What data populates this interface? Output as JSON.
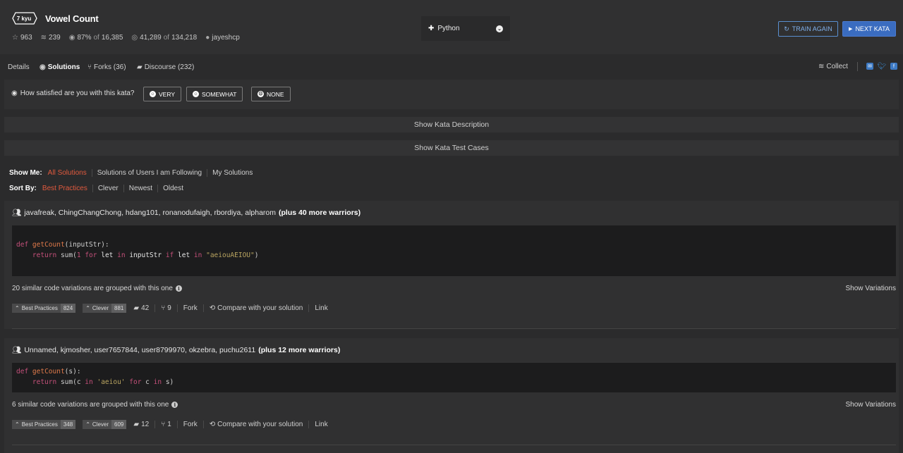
{
  "kata": {
    "rank": "7 kyu",
    "title": "Vowel Count",
    "stars": "963",
    "collections": "239",
    "satisfaction": "87%",
    "of_label": "of",
    "votes_total": "16,385",
    "completed": "41,289",
    "attempted": "134,218",
    "author": "jayeshcp"
  },
  "language": {
    "selected": "Python"
  },
  "buttons": {
    "train_again": "TRAIN AGAIN",
    "next_kata": "NEXT KATA"
  },
  "tabs": [
    {
      "label": "Details"
    },
    {
      "label": "Solutions"
    },
    {
      "label": "Forks (36)"
    },
    {
      "label": "Discourse (232)"
    }
  ],
  "collect_label": "Collect",
  "satisfaction": {
    "question": "How satisfied are you with this kata?",
    "options": [
      "VERY",
      "SOMEWHAT",
      "NONE"
    ]
  },
  "bars": {
    "description": "Show Kata Description",
    "tests": "Show Kata Test Cases"
  },
  "filters": {
    "show_label": "Show Me:",
    "show_options": [
      "All Solutions",
      "Solutions of Users I am Following",
      "My Solutions"
    ],
    "sort_label": "Sort By:",
    "sort_options": [
      "Best Practices",
      "Clever",
      "Newest",
      "Oldest"
    ]
  },
  "solutions": [
    {
      "users": "javafreak, ChingChangChong, hdang101, ronanodufaigh, rbordiya, alpharom",
      "more": "(plus 40 more warriors)",
      "similar": "20 similar code variations are grouped with this one",
      "show_variations": "Show Variations",
      "best_practices_label": "Best Practices",
      "best_practices": "824",
      "clever_label": "Clever",
      "clever": "881",
      "comments": "42",
      "forks": "9",
      "fork_label": "Fork",
      "compare_label": "Compare with your solution",
      "link_label": "Link",
      "code": {
        "line1": {
          "kw": "def",
          "fn": "getCount",
          "rest": "(inputStr):"
        },
        "line2": {
          "ret": "return",
          "sum": "sum(",
          "one": "1",
          "for": "for",
          "let1": "let",
          "in1": "in",
          "src": "inputStr",
          "if": "if",
          "let2": "let",
          "in2": "in",
          "str": "\"aeiouAEIOU\"",
          "close": ")"
        }
      }
    },
    {
      "users": "Unnamed, kjmosher, user7657844, user8799970, okzebra, puchu2611",
      "more": "(plus 12 more warriors)",
      "similar": "6 similar code variations are grouped with this one",
      "show_variations": "Show Variations",
      "best_practices_label": "Best Practices",
      "best_practices": "348",
      "clever_label": "Clever",
      "clever": "609",
      "comments": "12",
      "forks": "1",
      "fork_label": "Fork",
      "compare_label": "Compare with your solution",
      "link_label": "Link",
      "code": {
        "line1": {
          "kw": "def",
          "fn": "getCount",
          "rest": "(s):"
        },
        "line2": {
          "ret": "return",
          "sum": "sum(c",
          "in1": "in",
          "str": "'aeiou'",
          "for": "for",
          "c": "c",
          "in2": "in",
          "s": "s)"
        }
      }
    }
  ]
}
